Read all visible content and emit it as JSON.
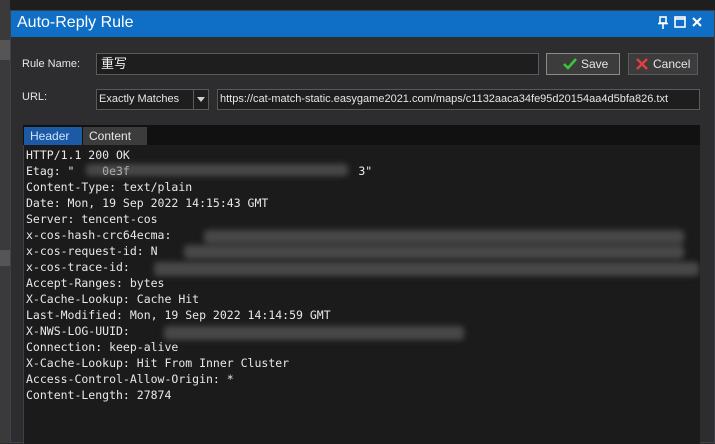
{
  "window": {
    "title": "Auto-Reply Rule"
  },
  "form": {
    "rule_name_label": "Rule Name:",
    "rule_name_value": "重写",
    "save_label": "Save",
    "cancel_label": "Cancel",
    "url_label": "URL:",
    "match_mode": "Exactly Matches",
    "url_value": "https://cat-match-static.easygame2021.com/maps/c1132aaca34fe95d20154aa4d5bfa826.txt"
  },
  "tabs": [
    {
      "label": "Header",
      "selected": true
    },
    {
      "label": "Content",
      "selected": false
    }
  ],
  "header_lines": [
    "HTTP/1.1 200 OK",
    "Etag: \"    0e3f                                 3\"",
    "Content-Type: text/plain",
    "Date: Mon, 19 Sep 2022 14:15:43 GMT",
    "Server: tencent-cos",
    "x-cos-hash-crc64ecma:",
    "x-cos-request-id: N",
    "x-cos-trace-id:",
    "Accept-Ranges: bytes",
    "X-Cache-Lookup: Cache Hit",
    "Last-Modified: Mon, 19 Sep 2022 14:14:59 GMT",
    "X-NWS-LOG-UUID:",
    "Connection: keep-alive",
    "X-Cache-Lookup: Hit From Inner Cluster",
    "Access-Control-Allow-Origin: *",
    "Content-Length: 27874"
  ],
  "colors": {
    "titlebar": "#0f6fc6",
    "save_check": "#3cc43c",
    "cancel_x": "#e04040"
  },
  "icons": {
    "pin": "pin-icon",
    "maximize": "maximize-icon",
    "close": "close-icon",
    "save": "check-icon",
    "cancel": "x-icon",
    "dropdown": "chevron-down-icon"
  }
}
